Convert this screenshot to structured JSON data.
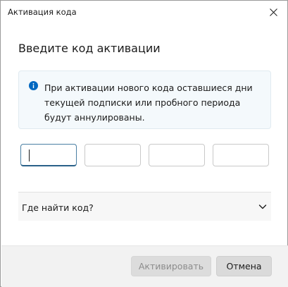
{
  "window": {
    "title": "Активация кода",
    "close_icon": "close-icon"
  },
  "main": {
    "heading": "Введите код активации",
    "info": {
      "icon": "info-icon",
      "color": "#0067c0",
      "text": "При активации нового кода оставшиеся дни текущей подписки или пробного периода будут аннулированы."
    },
    "code_fields": [
      {
        "value": "",
        "focused": true
      },
      {
        "value": "",
        "focused": false
      },
      {
        "value": "",
        "focused": false
      },
      {
        "value": "",
        "focused": false
      }
    ],
    "expander": {
      "label": "Где найти код?",
      "icon": "chevron-down-icon",
      "expanded": false
    }
  },
  "footer": {
    "primary_label": "Активировать",
    "primary_enabled": false,
    "secondary_label": "Отмена"
  }
}
